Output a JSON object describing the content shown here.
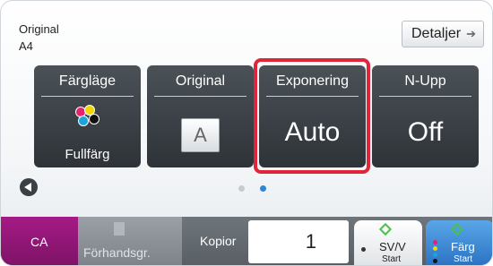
{
  "header": {
    "original_label": "Original",
    "paper_size": "A4",
    "details_button": "Detaljer"
  },
  "tiles": [
    {
      "title": "Färgläge",
      "value": "Fullfärg"
    },
    {
      "title": "Original",
      "value": "A"
    },
    {
      "title": "Exponering",
      "value": "Auto",
      "selected": true
    },
    {
      "title": "N-Upp",
      "value": "Off"
    }
  ],
  "colors": {
    "highlight": "#e0243a",
    "tile_bg": "#3b4046",
    "ca_bg": "#8f1776",
    "color_start_bg": "#3b8ad6"
  },
  "bottom": {
    "ca": "CA",
    "preview": "Förhandsgr.",
    "copies_label": "Kopior",
    "copies_value": "1",
    "mono_start_main": "SV/V",
    "mono_start_sub": "Start",
    "color_start_main": "Färg",
    "color_start_sub": "Start"
  },
  "pagination": {
    "page_count": 2,
    "active_page": 2
  }
}
